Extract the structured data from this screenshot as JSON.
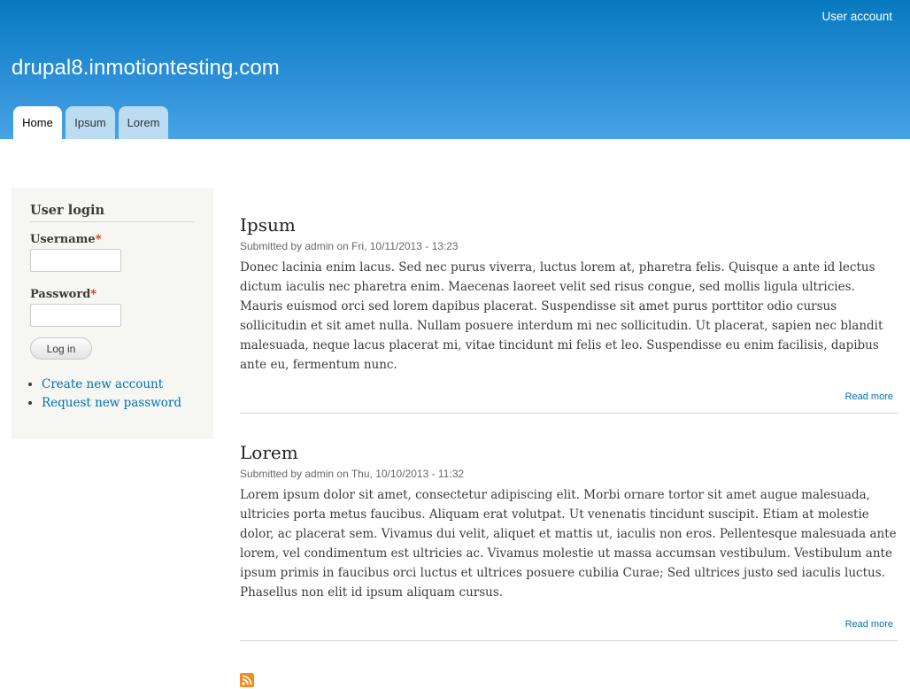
{
  "header": {
    "user_account": "User account",
    "site_name": "drupal8.inmotiontesting.com",
    "tabs": [
      {
        "label": "Home",
        "active": true
      },
      {
        "label": "Ipsum",
        "active": false
      },
      {
        "label": "Lorem",
        "active": false
      }
    ]
  },
  "sidebar": {
    "title": "User login",
    "username_label": "Username",
    "username_value": "",
    "password_label": "Password",
    "password_value": "",
    "required_mark": "*",
    "login_button": "Log in",
    "links": [
      "Create new account",
      "Request new password"
    ]
  },
  "articles": [
    {
      "title": "Ipsum",
      "submitted": "Submitted by admin on Fri, 10/11/2013 - 13:23",
      "body": "Donec lacinia enim lacus. Sed nec purus viverra, luctus lorem at, pharetra felis. Quisque a ante id lectus dictum iaculis nec pharetra enim. Maecenas laoreet velit sed risus congue, sed mollis ligula ultricies. Mauris euismod orci sed lorem dapibus placerat. Suspendisse sit amet purus porttitor odio cursus sollicitudin et sit amet nulla. Nullam posuere interdum mi nec sollicitudin. Ut placerat, sapien nec blandit malesuada, neque lacus placerat mi, vitae tincidunt mi felis et leo. Suspendisse eu enim facilisis, dapibus ante eu, fermentum nunc.",
      "read_more": "Read more"
    },
    {
      "title": "Lorem",
      "submitted": "Submitted by admin on Thu, 10/10/2013 - 11:32",
      "body": "Lorem ipsum dolor sit amet, consectetur adipiscing elit. Morbi ornare tortor sit amet augue malesuada, ultricies porta metus faucibus. Aliquam erat volutpat. Ut venenatis tincidunt suscipit. Etiam at molestie dolor, ac placerat sem. Vivamus dui velit, aliquet et mattis ut, iaculis non eros. Pellentesque malesuada ante lorem, vel condimentum est ultricies ac. Vivamus molestie ut massa accumsan vestibulum. Vestibulum ante ipsum primis in faucibus orci luctus et ultrices posuere cubilia Curae; Sed ultrices justo sed iaculis luctus. Phasellus non elit id ipsum aliquam cursus.",
      "read_more": "Read more"
    }
  ],
  "feed_icon": "rss-icon",
  "colors": {
    "header_top": "#0779bf",
    "header_bottom": "#48a3e4",
    "link": "#0071b3",
    "required": "#e32700",
    "feed": "#f78a1e"
  }
}
